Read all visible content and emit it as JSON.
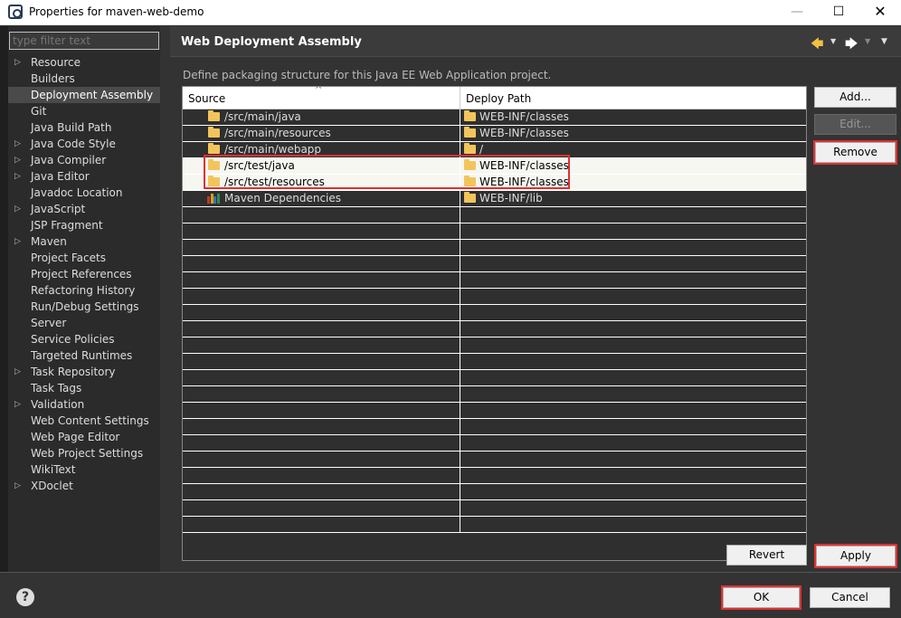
{
  "window": {
    "title": "Properties for maven-web-demo",
    "minimize": "—",
    "maximize": "☐",
    "close": "✕"
  },
  "sidebar": {
    "filter_placeholder": "type filter text",
    "items": [
      {
        "label": "Resource",
        "expandable": true
      },
      {
        "label": "Builders",
        "expandable": false
      },
      {
        "label": "Deployment Assembly",
        "expandable": false,
        "selected": true
      },
      {
        "label": "Git",
        "expandable": false
      },
      {
        "label": "Java Build Path",
        "expandable": false
      },
      {
        "label": "Java Code Style",
        "expandable": true
      },
      {
        "label": "Java Compiler",
        "expandable": true
      },
      {
        "label": "Java Editor",
        "expandable": true
      },
      {
        "label": "Javadoc Location",
        "expandable": false
      },
      {
        "label": "JavaScript",
        "expandable": true
      },
      {
        "label": "JSP Fragment",
        "expandable": false
      },
      {
        "label": "Maven",
        "expandable": true
      },
      {
        "label": "Project Facets",
        "expandable": false
      },
      {
        "label": "Project References",
        "expandable": false
      },
      {
        "label": "Refactoring History",
        "expandable": false
      },
      {
        "label": "Run/Debug Settings",
        "expandable": false
      },
      {
        "label": "Server",
        "expandable": false
      },
      {
        "label": "Service Policies",
        "expandable": false
      },
      {
        "label": "Targeted Runtimes",
        "expandable": false
      },
      {
        "label": "Task Repository",
        "expandable": true
      },
      {
        "label": "Task Tags",
        "expandable": false
      },
      {
        "label": "Validation",
        "expandable": true
      },
      {
        "label": "Web Content Settings",
        "expandable": false
      },
      {
        "label": "Web Page Editor",
        "expandable": false
      },
      {
        "label": "Web Project Settings",
        "expandable": false
      },
      {
        "label": "WikiText",
        "expandable": false
      },
      {
        "label": "XDoclet",
        "expandable": true
      }
    ]
  },
  "header": {
    "title": "Web Deployment Assembly",
    "back_icon": "🡄",
    "forward_icon": "🡆"
  },
  "main": {
    "description": "Define packaging structure for this Java EE Web Application project.",
    "columns": {
      "source": "Source",
      "deploy": "Deploy Path"
    },
    "rows": [
      {
        "source": "/src/main/java",
        "deploy": "WEB-INF/classes",
        "icon": "folder-icon"
      },
      {
        "source": "/src/main/resources",
        "deploy": "WEB-INF/classes",
        "icon": "folder-icon"
      },
      {
        "source": "/src/main/webapp",
        "deploy": "/",
        "icon": "folder-icon"
      },
      {
        "source": "/src/test/java",
        "deploy": "WEB-INF/classes",
        "icon": "folder-icon",
        "highlighted": true
      },
      {
        "source": "/src/test/resources",
        "deploy": "WEB-INF/classes",
        "icon": "folder-icon",
        "highlighted": true
      },
      {
        "source": "Maven Dependencies",
        "deploy": "WEB-INF/lib",
        "icon": "library-icon"
      }
    ],
    "empty_rows": 20
  },
  "buttons": {
    "add": "Add...",
    "edit": "Edit...",
    "remove": "Remove",
    "revert": "Revert",
    "apply": "Apply",
    "ok": "OK",
    "cancel": "Cancel",
    "help": "?"
  },
  "colors": {
    "highlight_border": "#e03030",
    "folder": "#f2c55c"
  }
}
